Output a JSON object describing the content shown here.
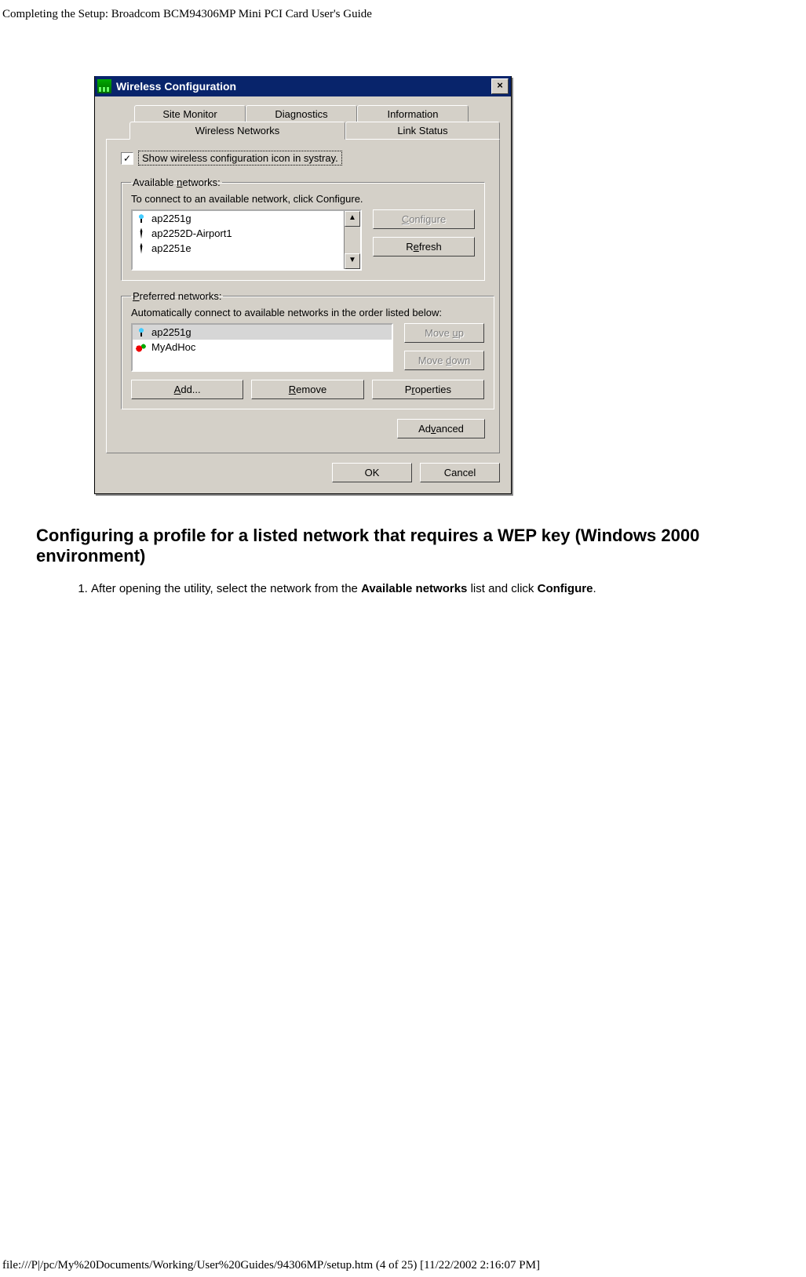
{
  "page_header": "Completing the Setup: Broadcom BCM94306MP Mini PCI Card User's Guide",
  "dialog": {
    "title": "Wireless Configuration",
    "tabs_row1": [
      "Site Monitor",
      "Diagnostics",
      "Information"
    ],
    "tabs_row2": [
      "Wireless Networks",
      "Link Status"
    ],
    "checkbox_label": "Show wireless configuration icon in systray.",
    "available": {
      "legend_prefix": "Available ",
      "legend_uline": "n",
      "legend_suffix": "etworks:",
      "desc": "To connect to an available network, click Configure.",
      "items": [
        "ap2251g",
        "ap2252D-Airport1",
        "ap2251e"
      ],
      "btn_configure_u": "C",
      "btn_configure_rest": "onfigure",
      "btn_refresh_pre": "R",
      "btn_refresh_u": "e",
      "btn_refresh_rest": "fresh"
    },
    "preferred": {
      "legend_u": "P",
      "legend_rest": "referred networks:",
      "desc": "Automatically connect to available networks in the order listed below:",
      "items": [
        "ap2251g",
        "MyAdHoc"
      ],
      "btn_moveup_pre": "Move ",
      "btn_moveup_u": "u",
      "btn_moveup_post": "p",
      "btn_movedown_pre": "Move ",
      "btn_movedown_u": "d",
      "btn_movedown_post": "own",
      "btn_add_u": "A",
      "btn_add_rest": "dd...",
      "btn_remove_u": "R",
      "btn_remove_rest": "emove",
      "btn_props_pre": "P",
      "btn_props_u": "r",
      "btn_props_post": "operties"
    },
    "btn_advanced_pre": "Ad",
    "btn_advanced_u": "v",
    "btn_advanced_post": "anced",
    "btn_ok": "OK",
    "btn_cancel": "Cancel"
  },
  "section_heading": "Configuring a profile for a listed network that requires a WEP key (Windows 2000 environment)",
  "step1_pre": "After opening the utility, select the network from the ",
  "step1_b1": "Available networks",
  "step1_mid": " list and click ",
  "step1_b2": "Configure",
  "step1_end": ".",
  "footer": "file:///P|/pc/My%20Documents/Working/User%20Guides/94306MP/setup.htm (4 of 25) [11/22/2002 2:16:07 PM]"
}
